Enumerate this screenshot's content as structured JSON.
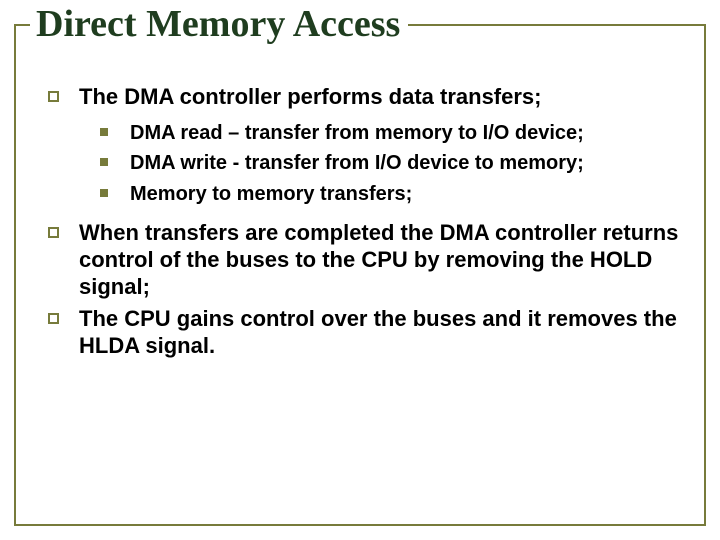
{
  "title": "Direct Memory Access",
  "bullets": {
    "b1": "The DMA controller performs data transfers;",
    "b1_sub": {
      "s1": "DMA read – transfer from memory to I/O device;",
      "s2": "DMA write - transfer from I/O device to memory;",
      "s3": "Memory to memory transfers;"
    },
    "b2": "When transfers are completed the DMA controller returns control of the buses to the CPU by removing the HOLD signal;",
    "b3": "The CPU gains control over the buses and it removes the HLDA signal."
  }
}
